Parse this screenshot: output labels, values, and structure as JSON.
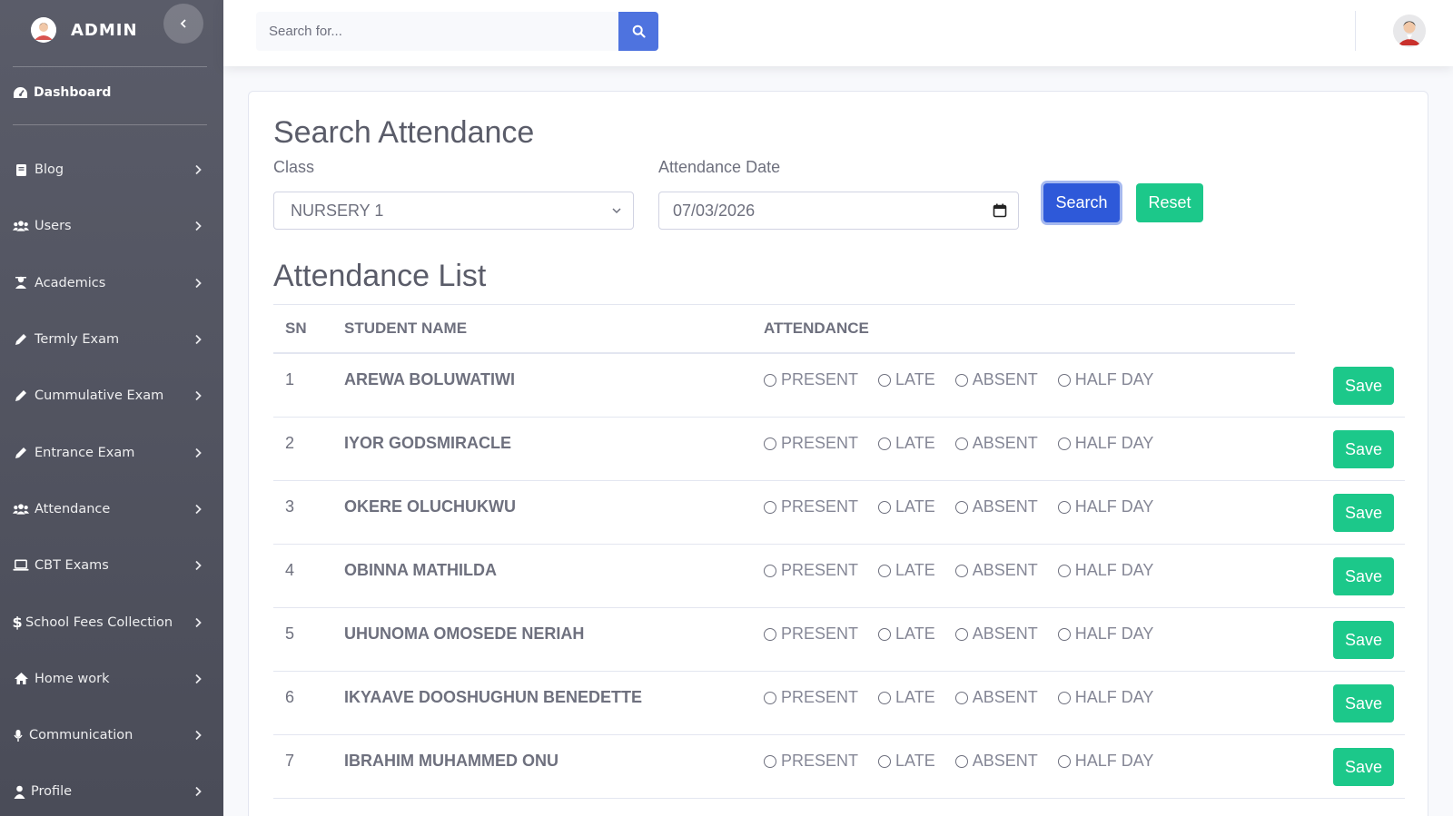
{
  "sidebar": {
    "brand": "ADMIN",
    "dashboard": "Dashboard",
    "items": [
      {
        "label": "Blog",
        "icon": "book-icon"
      },
      {
        "label": "Users",
        "icon": "users-icon"
      },
      {
        "label": "Academics",
        "icon": "teacher-icon"
      },
      {
        "label": "Termly Exam",
        "icon": "pencil-icon"
      },
      {
        "label": "Cummulative Exam",
        "icon": "pencil-icon"
      },
      {
        "label": "Entrance Exam",
        "icon": "pencil-icon"
      },
      {
        "label": "Attendance",
        "icon": "users-icon"
      },
      {
        "label": "CBT Exams",
        "icon": "laptop-icon"
      },
      {
        "label": "School Fees Collection",
        "icon": "dollar-icon"
      },
      {
        "label": "Home work",
        "icon": "home-icon"
      },
      {
        "label": "Communication",
        "icon": "microphone-icon"
      },
      {
        "label": "Profile",
        "icon": "user-icon"
      }
    ]
  },
  "topbar": {
    "search_placeholder": "Search for..."
  },
  "search_section": {
    "title": "Search Attendance",
    "class_label": "Class",
    "class_value": "NURSERY 1",
    "date_label": "Attendance Date",
    "date_value": "07/03/2026",
    "search_label": "Search",
    "reset_label": "Reset"
  },
  "attendance_list": {
    "title": "Attendance List",
    "headers": {
      "sn": "SN",
      "name": "STUDENT NAME",
      "attendance": "ATTENDANCE"
    },
    "options": [
      "PRESENT",
      "LATE",
      "ABSENT",
      "HALF DAY"
    ],
    "save_label": "Save",
    "rows": [
      {
        "sn": "1",
        "name": "AREWA BOLUWATIWI"
      },
      {
        "sn": "2",
        "name": "IYOR GODSMIRACLE"
      },
      {
        "sn": "3",
        "name": "OKERE OLUCHUKWU"
      },
      {
        "sn": "4",
        "name": "OBINNA MATHILDA"
      },
      {
        "sn": "5",
        "name": "UHUNOMA OMOSEDE NERIAH"
      },
      {
        "sn": "6",
        "name": "IKYAAVE DOOSHUGHUN BENEDETTE"
      },
      {
        "sn": "7",
        "name": "IBRAHIM MUHAMMED ONU"
      }
    ]
  },
  "colors": {
    "primary": "#4e73df",
    "success": "#1cc88a",
    "sidebar": "#5a5c69"
  }
}
